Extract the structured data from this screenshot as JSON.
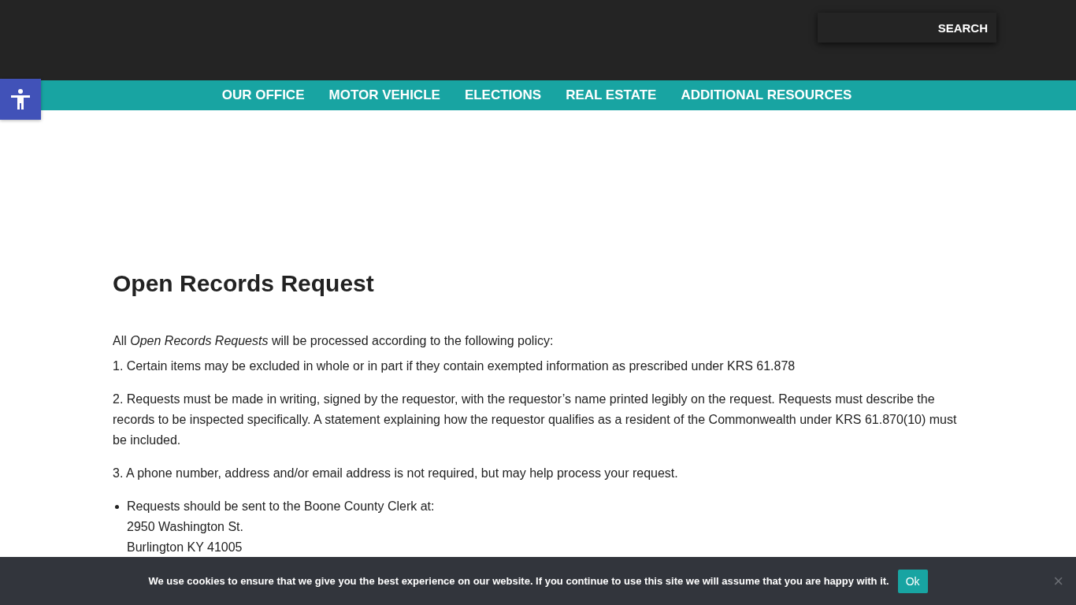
{
  "header": {
    "search": {
      "button": "SEARCH"
    }
  },
  "nav": {
    "items": [
      {
        "label": "OUR OFFICE"
      },
      {
        "label": "MOTOR VEHICLE"
      },
      {
        "label": "ELECTIONS"
      },
      {
        "label": "REAL ESTATE"
      },
      {
        "label": "ADDITIONAL RESOURCES"
      }
    ]
  },
  "content": {
    "title": "Open Records Request",
    "intro": "All *Open Records Requests* will be processed according to the following policy:",
    "paragraphs": [
      "1. Certain items may be excluded in whole or in part if they contain exempted information as prescribed under KRS 61.878",
      "2. Requests must be made in writing, signed by the requestor, with the requestor’s name printed legibly on the request. Requests must describe the records to be inspected specifically.  A statement explaining how the requestor qualifies as a resident of the Commonwealth under KRS 61.870(10) must be included.",
      "3. A phone number, address and/or email address is not required, but may help process your request."
    ],
    "bullets": [
      {
        "lines": [
          "Requests should be sent to the Boone County Clerk at:",
          "2950 Washington St.",
          "Burlington KY 41005"
        ]
      }
    ]
  },
  "cookie_bar": {
    "message": "We use cookies to ensure that we give you the best experience on our website. If you continue to use this site we will assume that you are happy with it.",
    "button": "Ok",
    "close": "×"
  }
}
